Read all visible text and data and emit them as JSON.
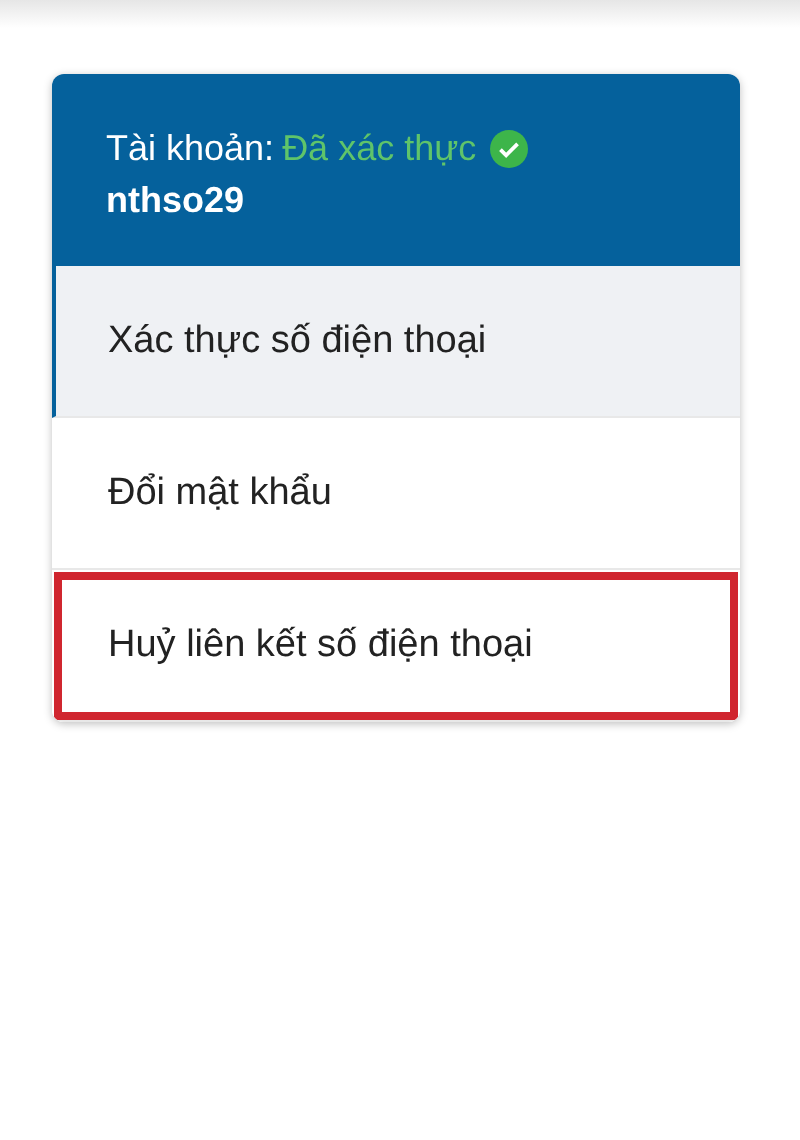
{
  "account": {
    "label": "Tài khoản:",
    "status": "Đã xác thực",
    "verified": true,
    "username": "nthso29"
  },
  "menu": [
    {
      "label": "Xác thực số điện thoại",
      "selected": true,
      "highlighted": false
    },
    {
      "label": "Đổi mật khẩu",
      "selected": false,
      "highlighted": false
    },
    {
      "label": "Huỷ liên kết số điện thoại",
      "selected": false,
      "highlighted": true
    }
  ]
}
